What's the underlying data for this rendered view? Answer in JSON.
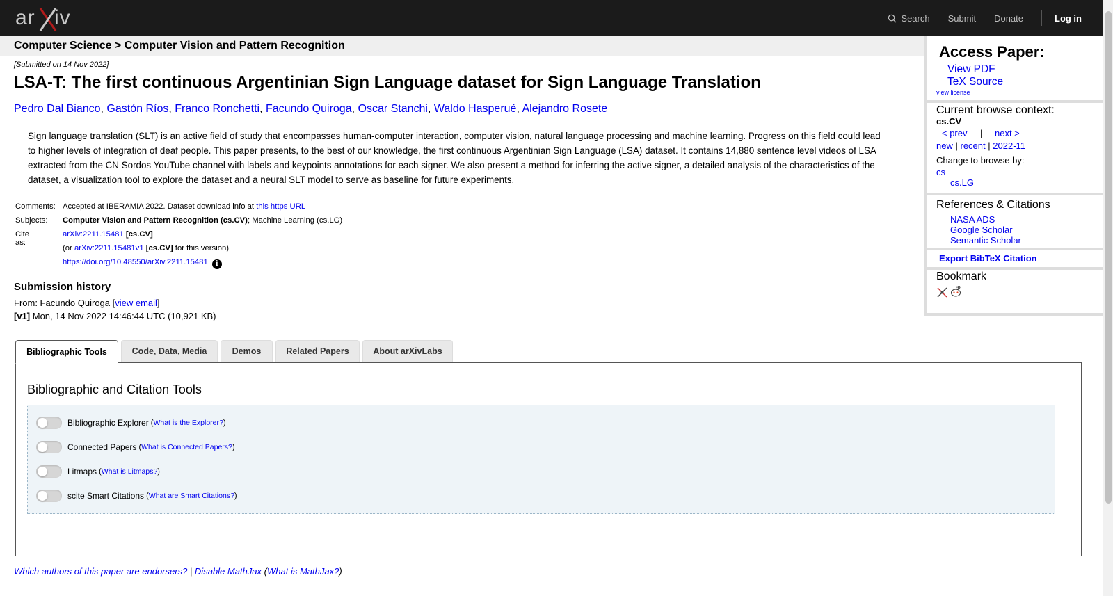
{
  "nav": {
    "logo_text": "arXiv",
    "search_label": "Search",
    "submit_label": "Submit",
    "donate_label": "Donate",
    "login_label": "Log in"
  },
  "breadcrumb": "Computer Science > Computer Vision and Pattern Recognition",
  "paper": {
    "submitted": "[Submitted on 14 Nov 2022]",
    "title": "LSA-T: The first continuous Argentinian Sign Language dataset for Sign Language Translation",
    "authors": [
      "Pedro Dal Bianco",
      "Gastón Ríos",
      "Franco Ronchetti",
      "Facundo Quiroga",
      "Oscar Stanchi",
      "Waldo Hasperué",
      "Alejandro Rosete"
    ],
    "abstract_lines": [
      "Sign language translation (SLT) is an active field of study that encompasses human-computer interaction, computer vision, natural language processing and machine learning. Progress on this field could lead",
      "to higher levels of integration of deaf people. This paper presents, to the best of our knowledge, the first continuous Argentinian Sign Language (LSA) dataset. It contains 14,880 sentence level videos of LSA",
      "extracted from the CN Sordos YouTube channel with labels and keypoints annotations for each signer. We also present a method for inferring the active signer, a detailed analysis of the characteristics of the",
      "dataset, a visualization tool to explore the dataset and a neural SLT model to serve as baseline for future experiments."
    ],
    "comments_label": "Comments:",
    "comments_text": "Accepted at IBERAMIA 2022. Dataset download info at ",
    "comments_link": "this https URL",
    "subjects_label": "Subjects:",
    "subjects_primary": "Computer Vision and Pattern Recognition (cs.CV)",
    "subjects_secondary": "; Machine Learning (cs.LG)",
    "cite_label": "Cite as:",
    "cite_id": "arXiv:2211.15481",
    "cite_cat": "[cs.CV]",
    "cite_version_pre": "(or ",
    "cite_version_id": "arXiv:2211.15481v1",
    "cite_version_cat": "[cs.CV]",
    "cite_version_post": " for this version)",
    "doi": "https://doi.org/10.48550/arXiv.2211.15481",
    "info_icon": "i"
  },
  "history": {
    "heading": "Submission history",
    "from_text": "From: Facundo Quiroga [",
    "view_email": "view email",
    "from_close": "]",
    "v1_tag": "[v1]",
    "v1_text": " Mon, 14 Nov 2022 14:46:44 UTC (10,921 KB)"
  },
  "sidebar": {
    "access_heading": "Access Paper:",
    "view_pdf": "View PDF",
    "tex_source": "TeX Source",
    "view_license": "view license",
    "browse_heading": "Current browse context:",
    "browse_context": "cs.CV",
    "prev": "< prev",
    "pipe": "|",
    "next": "next >",
    "new": "new",
    "recent": "recent",
    "month": "2022-11",
    "change_browse": "Change to browse by:",
    "browse_cs": "cs",
    "browse_cslg": "cs.LG",
    "refs_heading": "References & Citations",
    "nasa": "NASA ADS",
    "google": "Google Scholar",
    "semantic": "Semantic Scholar",
    "bibtex": "Export BibTeX Citation",
    "bookmark_heading": "Bookmark"
  },
  "tabs": [
    "Bibliographic Tools",
    "Code, Data, Media",
    "Demos",
    "Related Papers",
    "About arXivLabs"
  ],
  "panel": {
    "title": "Bibliographic and Citation Tools",
    "tools": [
      {
        "label": "Bibliographic Explorer",
        "help": "What is the Explorer?"
      },
      {
        "label": "Connected Papers",
        "help": "What is Connected Papers?"
      },
      {
        "label": "Litmaps",
        "help": "What is Litmaps?"
      },
      {
        "label": "scite Smart Citations",
        "help": "What are Smart Citations?"
      }
    ]
  },
  "footer": {
    "endorsers": "Which authors of this paper are endorsers?",
    "sep": " | ",
    "disable_mathjax": "Disable MathJax",
    "what_mathjax": "What is MathJax?"
  },
  "colors": {
    "topbar": "#1b1b1b",
    "link": "#0000ee",
    "logo_x": "#b31b1b"
  }
}
